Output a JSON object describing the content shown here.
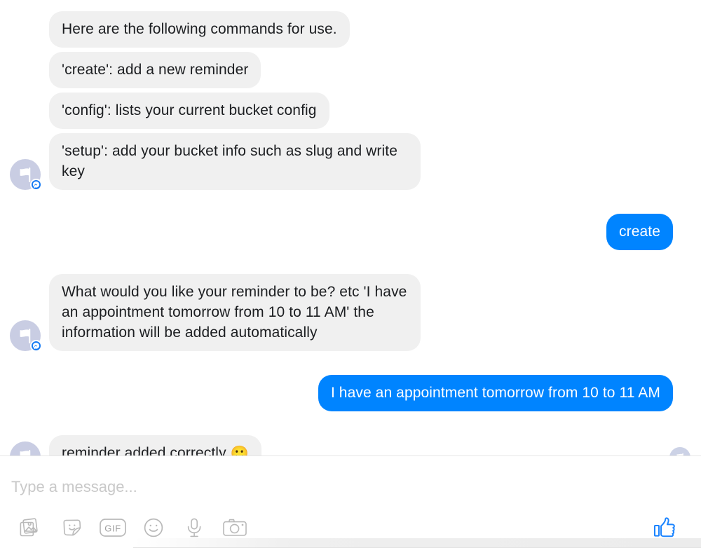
{
  "app": {
    "name": "Messenger",
    "background_color": "#ffffff"
  },
  "colors": {
    "incoming_bubble": "#f0f0f0",
    "incoming_text": "#1c1e21",
    "outgoing_bubble": "#0084ff",
    "outgoing_text": "#ffffff",
    "avatar_background": "#c9cde3",
    "badge_blue": "#1278f3",
    "placeholder": "#c9c9c9",
    "icon_gray": "#b8b8b8",
    "like_blue": "#0084ff"
  },
  "conversation": {
    "groups": [
      {
        "side": "incoming",
        "avatar": {
          "icon": "flag-avatar-icon",
          "badge": "messenger-badge-icon"
        },
        "messages": [
          {
            "text": "Here are the following commands for use."
          },
          {
            "text": "'create': add a new reminder"
          },
          {
            "text": "'config': lists your current bucket config"
          },
          {
            "text": "'setup': add your bucket info such as slug and write key"
          }
        ]
      },
      {
        "side": "outgoing",
        "messages": [
          {
            "text": "create"
          }
        ]
      },
      {
        "side": "incoming",
        "avatar": {
          "icon": "flag-avatar-icon",
          "badge": "messenger-badge-icon"
        },
        "messages": [
          {
            "text": "What would you like your reminder to be? etc 'I have an appointment tomorrow from 10 to 11 AM' the information will be added automatically"
          }
        ]
      },
      {
        "side": "outgoing",
        "messages": [
          {
            "text": "I have an appointment tomorrow from 10 to 11 AM"
          }
        ]
      },
      {
        "side": "incoming",
        "avatar": {
          "icon": "flag-avatar-icon",
          "badge": "messenger-badge-icon"
        },
        "messages": [
          {
            "text": "reminder added correctly ",
            "emoji": "🙂"
          }
        ]
      }
    ],
    "seen_indicator": {
      "icon": "flag-avatar-icon",
      "label": "Seen"
    }
  },
  "composer": {
    "input": {
      "value": "",
      "placeholder": "Type a message..."
    },
    "tools": [
      {
        "name": "photo-gallery-icon",
        "label": "Photos"
      },
      {
        "name": "sticker-icon",
        "label": "Stickers"
      },
      {
        "name": "gif-icon",
        "label": "GIF"
      },
      {
        "name": "emoji-icon",
        "label": "Emoji"
      },
      {
        "name": "microphone-icon",
        "label": "Voice"
      },
      {
        "name": "camera-icon",
        "label": "Camera"
      }
    ],
    "gif_label": "GIF",
    "like_button": {
      "name": "thumbs-up-icon",
      "label": "Like"
    }
  }
}
